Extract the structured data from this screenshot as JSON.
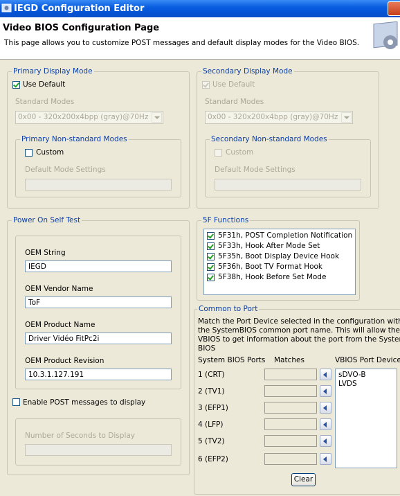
{
  "window": {
    "title": "IEGD Configuration Editor"
  },
  "header": {
    "title": "Video BIOS Configuration Page",
    "description": "This page allows you to customize POST messages and default display modes for the Video BIOS."
  },
  "primary": {
    "legend": "Primary Display Mode",
    "use_default_label": "Use Default",
    "use_default_checked": true,
    "standard_modes_label": "Standard Modes",
    "standard_mode_value": "0x00 - 320x200x4bpp (gray)@70Hz",
    "nonstandard": {
      "legend": "Primary Non-standard Modes",
      "custom_label": "Custom",
      "custom_checked": false,
      "default_mode_settings_label": "Default Mode Settings",
      "default_mode_settings_value": ""
    }
  },
  "secondary": {
    "legend": "Secondary Display Mode",
    "use_default_label": "Use Default",
    "use_default_checked": true,
    "standard_modes_label": "Standard Modes",
    "standard_mode_value": "0x00 - 320x200x4bpp (gray)@70Hz",
    "nonstandard": {
      "legend": "Secondary Non-standard Modes",
      "custom_label": "Custom",
      "custom_checked": false,
      "default_mode_settings_label": "Default Mode Settings",
      "default_mode_settings_value": ""
    }
  },
  "post": {
    "legend": "Power On Self Test",
    "oem_string_label": "OEM String",
    "oem_string_value": "IEGD",
    "oem_vendor_label": "OEM Vendor Name",
    "oem_vendor_value": "ToF",
    "oem_product_label": "OEM Product Name",
    "oem_product_value": "Driver Vidéo FitPc2i",
    "oem_revision_label": "OEM Product Revision",
    "oem_revision_value": "10.3.1.127.191",
    "enable_post_label": "Enable POST messages to display",
    "enable_post_checked": false,
    "seconds_label": "Number of Seconds to Display",
    "seconds_value": ""
  },
  "functions_5f": {
    "legend": "5F Functions",
    "items": [
      {
        "label": "5F31h, POST Completion Notification",
        "checked": true
      },
      {
        "label": "5F33h, Hook After Mode Set",
        "checked": true
      },
      {
        "label": "5F35h, Boot Display Device Hook",
        "checked": true
      },
      {
        "label": "5F36h, Boot TV Format Hook",
        "checked": true
      },
      {
        "label": "5F38h, Hook Before Set Mode",
        "checked": true
      }
    ]
  },
  "common_port": {
    "legend": "Common to Port",
    "description_lines": [
      "Match the Port Device selected in the configuration with",
      "the SystemBIOS common port name. This will allow the",
      "VBIOS to get information about the port from the System",
      "BIOS"
    ],
    "col_system": "System BIOS Ports",
    "col_matches": "Matches",
    "col_vbios": "VBIOS Port Devices",
    "ports": [
      "1 (CRT)",
      "2 (TV1)",
      "3 (EFP1)",
      "4 (LFP)",
      "5 (TV2)",
      "6 (EFP2)"
    ],
    "vbios_devices": [
      "sDVO-B",
      "LVDS"
    ],
    "clear_label": "Clear"
  },
  "colors": {
    "title_bar": "#0A5FE0",
    "legend_text": "#0B3EA6",
    "background": "#ECE9D8"
  }
}
